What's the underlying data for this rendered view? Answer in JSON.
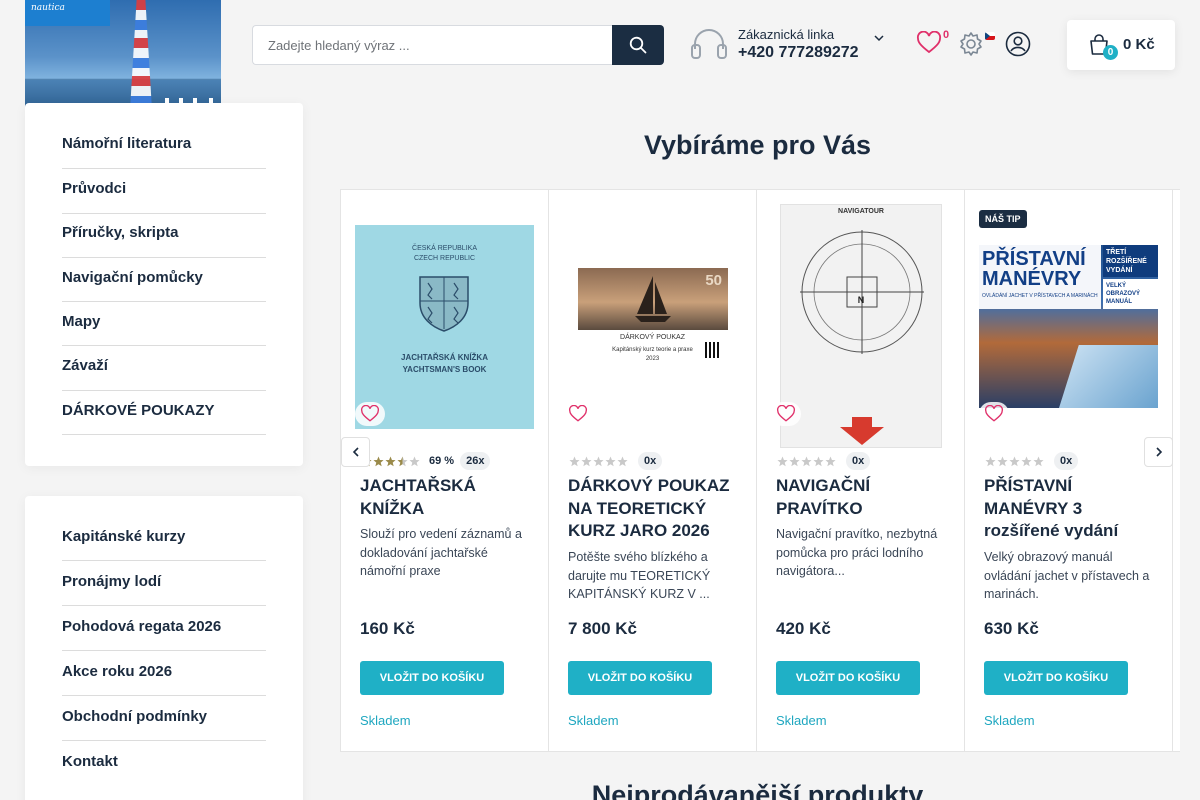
{
  "header": {
    "logo_text": "nautica",
    "search": {
      "placeholder": "Zadejte hledaný výraz ..."
    },
    "hotline": {
      "label": "Zákaznická linka",
      "phone": "+420 777289272"
    },
    "wishlist_count": "0",
    "cart": {
      "badge": "0",
      "total": "0 Kč"
    }
  },
  "sidebar": {
    "categories": [
      "Námořní literatura",
      "Průvodci",
      "Příručky, skripta",
      "Navigační pomůcky",
      "Mapy",
      "Závaží",
      "DÁRKOVÉ POUKAZY"
    ],
    "links": [
      "Kapitánské kurzy",
      "Pronájmy lodí",
      "Pohodová regata 2026",
      "Akce roku 2026",
      "Obchodní podmínky",
      "Kontakt"
    ]
  },
  "section_title": "Vybíráme pro Vás",
  "section_title_2": "Nejprodávanější produkty",
  "products": [
    {
      "title": "JACHTAŘSKÁ KNÍŽKA",
      "rating_pct": "69 %",
      "reviews": "26x",
      "desc": "Slouží pro vedení záznamů a dokladování jachtařské námořní praxe",
      "price": "160 Kč",
      "button": "VLOŽIT DO KOŠÍKU",
      "stock": "Skladem",
      "image_text": {
        "line1": "ČESKÁ REPUBLIKA",
        "line2": "CZECH REPUBLIC",
        "line3": "JACHTAŘSKÁ KNÍŽKA",
        "line4": "YACHTSMAN'S BOOK"
      }
    },
    {
      "title": "DÁRKOVÝ POUKAZ NA TEORETICKÝ KURZ JARO 2026",
      "reviews": "0x",
      "desc": "Potěšte svého blízkého a darujte mu TEORETICKÝ KAPITÁNSKÝ KURZ V ...",
      "price": "7 800 Kč",
      "button": "VLOŽIT DO KOŠÍKU",
      "stock": "Skladem",
      "image_text": {
        "line1": "DÁRKOVÝ POUKAZ",
        "line2": "Kapitánský kurz teorie a praxe",
        "line3": "2023",
        "value": "50"
      }
    },
    {
      "title": "NAVIGAČNÍ PRAVÍTKO",
      "reviews": "0x",
      "desc": "Navigační pravítko, nezbytná pomůcka pro práci lodního navigátora...",
      "price": "420 Kč",
      "button": "VLOŽIT DO KOŠÍKU",
      "stock": "Skladem",
      "image_text": {
        "brand": "NAVIGATOUR",
        "north": "N"
      }
    },
    {
      "title": "PŘÍSTAVNÍ MANÉVRY 3 rozšířené vydání",
      "badge": "NÁŠ TIP",
      "reviews": "0x",
      "desc": "Velký obrazový manuál ovládání jachet v přístavech a marinách.",
      "price": "630 Kč",
      "button": "VLOŽIT DO KOŠÍKU",
      "stock": "Skladem",
      "image_text": {
        "title": "PŘÍSTAVNÍ MANÉVRY",
        "edition": "TŘETÍ ROZŠÍŘENÉ VYDÁNÍ",
        "sub": "OVLÁDÁNÍ JACHET V PŘÍSTAVECH A MARINÁCH",
        "manual": "VELKÝ OBRAZOVÝ MANUÁL"
      }
    }
  ],
  "colors": {
    "accent": "#1fb0c6",
    "dark": "#1b2d42",
    "wish": "#e0306a"
  }
}
